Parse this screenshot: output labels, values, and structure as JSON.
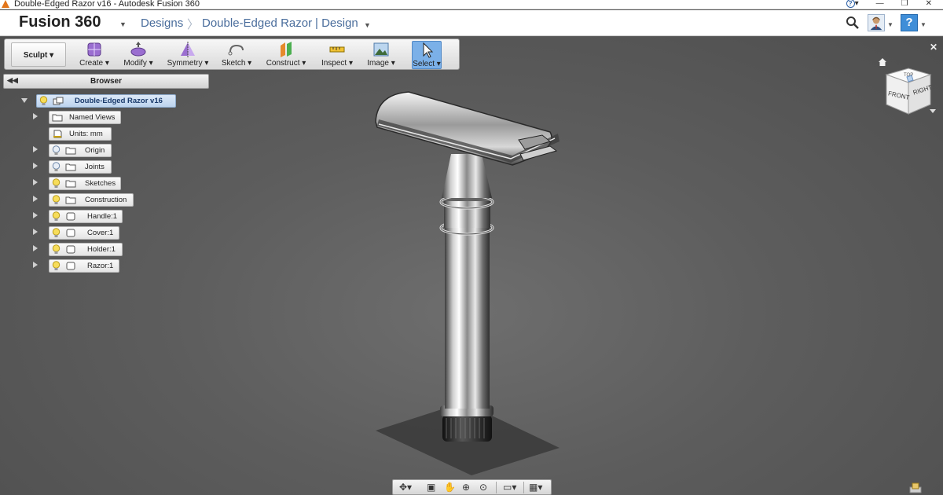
{
  "window": {
    "title": "Double-Edged Razor v16 - Autodesk Fusion 360"
  },
  "header": {
    "brand": "Fusion 360",
    "breadcrumbs": [
      "Designs",
      "Double-Edged Razor",
      "| Design"
    ]
  },
  "toolbar": {
    "workspace": "Sculpt ▾",
    "tools": [
      {
        "label": "Create ▾",
        "icon": "create-box-icon"
      },
      {
        "label": "Modify ▾",
        "icon": "modify-icon"
      },
      {
        "label": "Symmetry ▾",
        "icon": "symmetry-icon"
      },
      {
        "label": "Sketch ▾",
        "icon": "sketch-icon"
      },
      {
        "label": "Construct ▾",
        "icon": "construct-icon"
      },
      {
        "label": "Inspect ▾",
        "icon": "inspect-icon"
      },
      {
        "label": "Image ▾",
        "icon": "image-icon"
      },
      {
        "label": "Select ▾",
        "icon": "select-cursor-icon",
        "selected": true
      }
    ]
  },
  "browser": {
    "title": "Browser",
    "root": "Double-Edged Razor v16",
    "items": [
      "Named Views",
      "Units: mm",
      "Origin",
      "Joints",
      "Sketches",
      "Construction",
      "Handle:1",
      "Cover:1",
      "Holder:1",
      "Razor:1"
    ]
  },
  "viewcube": {
    "front": "FRONT",
    "right": "RIGHT",
    "top": "TOP"
  },
  "colors": {
    "viewport_bg": "#595959",
    "accent": "#4a6d9c",
    "selected_tool": "#7bb0e8"
  }
}
